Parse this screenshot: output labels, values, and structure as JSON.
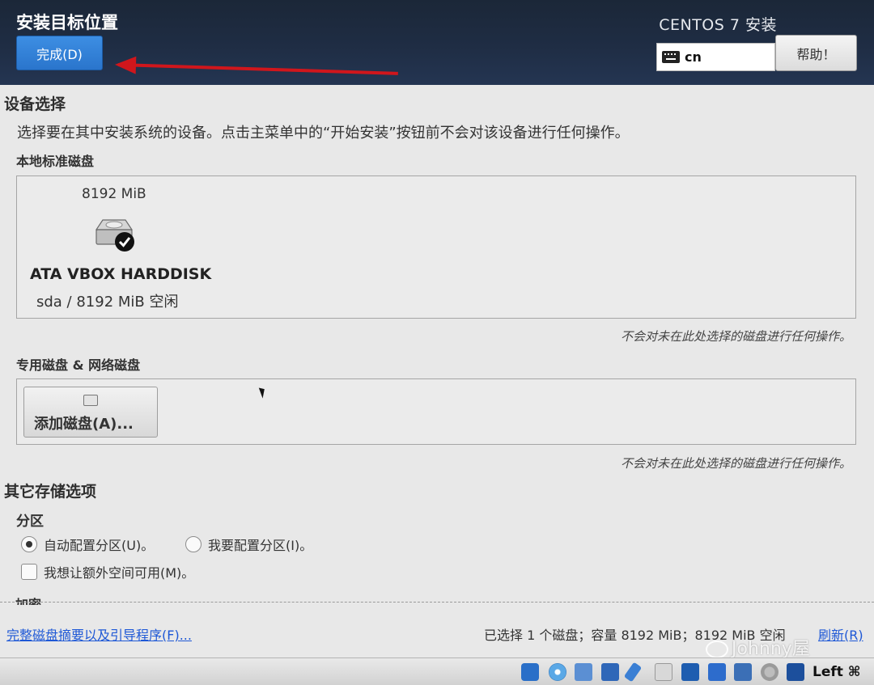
{
  "header": {
    "title": "安装目标位置",
    "done_label": "完成(D)",
    "product": "CENTOS 7 安装",
    "keyboard_layout": "cn",
    "help_label": "帮助！"
  },
  "device_selection": {
    "heading": "设备选择",
    "description": "选择要在其中安装系统的设备。点击主菜单中的“开始安装”按钮前不会对该设备进行任何操作。",
    "local_disks_label": "本地标准磁盘",
    "disk": {
      "size": "8192 MiB",
      "name": "ATA VBOX HARDDISK",
      "detail": "sda   /   8192 MiB 空闲",
      "selected": true
    },
    "local_note": "不会对未在此处选择的磁盘进行任何操作。",
    "special_disks_label": "专用磁盘 & 网络磁盘",
    "add_disk_label": "添加磁盘(A)...",
    "special_note": "不会对未在此处选择的磁盘进行任何操作。"
  },
  "other_storage": {
    "heading": "其它存储选项",
    "partition_label": "分区",
    "auto_partition": "自动配置分区(U)。",
    "manual_partition": "我要配置分区(I)。",
    "extra_space": "我想让额外空间可用(M)。",
    "encryption_label": "加密"
  },
  "footer": {
    "summary_link": "完整磁盘摘要以及引导程序(F)...",
    "summary": "已选择 1 个磁盘；容量 8192 MiB；8192 MiB 空闲",
    "refresh": "刷新(R)",
    "watermark": "Johnny屋"
  },
  "statusbar": {
    "host_key": "Left ⌘",
    "icons": [
      "hard-disk-icon",
      "optical-disk-icon",
      "audio-icon",
      "network-icon",
      "usb-icon",
      "shared-folder-icon",
      "display-icon",
      "screen-capture-icon",
      "video-capture-icon",
      "cpu-icon",
      "mouse-integration-icon",
      "keyboard-capture-icon"
    ]
  },
  "colors": {
    "header_bg": "#1f2d44",
    "primary_button": "#2a75cc",
    "link": "#1e58d6",
    "annotation_arrow": "#d0161c"
  }
}
